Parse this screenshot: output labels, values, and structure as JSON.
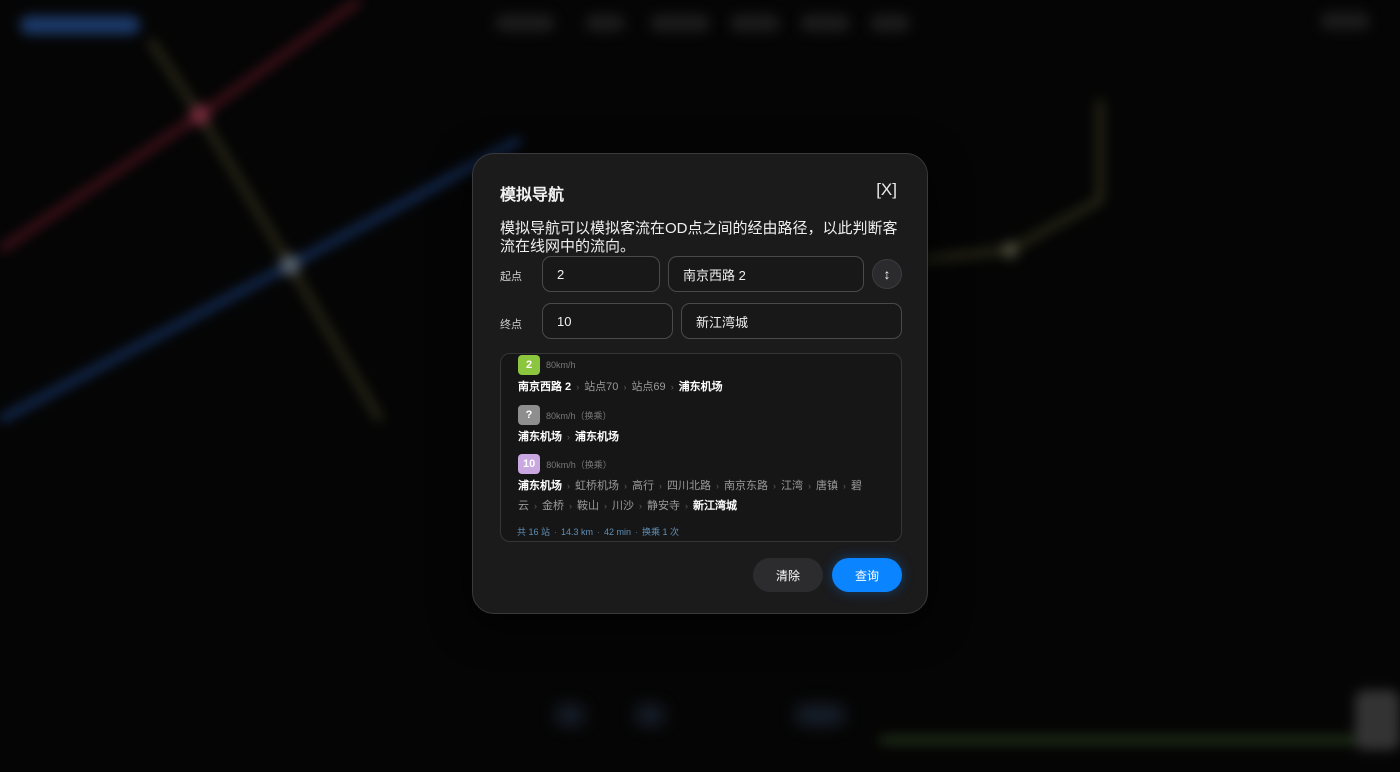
{
  "dialog": {
    "title": "模拟导航",
    "close_label": "[X]",
    "description": "模拟导航可以模拟客流在OD点之间的经由路径，以此判断客流在线网中的流向。"
  },
  "form": {
    "origin_label": "起点",
    "origin_line": "2",
    "origin_station": "南京西路 2",
    "swap_icon": "↕",
    "destination_label": "终点",
    "destination_line": "10",
    "destination_station": "新江湾城"
  },
  "route": {
    "segments": [
      {
        "line": "2",
        "color": "#8cc63f",
        "speed": "80km/h",
        "stations": [
          "南京西路 2",
          "站点70",
          "站点69",
          "浦东机场"
        ]
      },
      {
        "line": "?",
        "color": "#8e8e8e",
        "speed": "80km/h（换乘）",
        "stations": [
          "浦东机场",
          "浦东机场"
        ]
      },
      {
        "line": "10",
        "color": "#c9a7e0",
        "speed": "80km/h（换乘）",
        "stations": [
          "浦东机场",
          "虹桥机场",
          "高行",
          "四川北路",
          "南京东路",
          "江湾",
          "唐镇",
          "碧云",
          "金桥",
          "鞍山",
          "川沙",
          "静安寺",
          "新江湾城"
        ]
      }
    ],
    "summary": {
      "stations": "共 16 站",
      "distance": "14.3 km",
      "duration": "42 min",
      "transfers": "换乘 1 次"
    },
    "arrow_glyph": "›"
  },
  "actions": {
    "clear_label": "清除",
    "query_label": "查询"
  },
  "colors": {
    "accent": "#0a84ff"
  }
}
